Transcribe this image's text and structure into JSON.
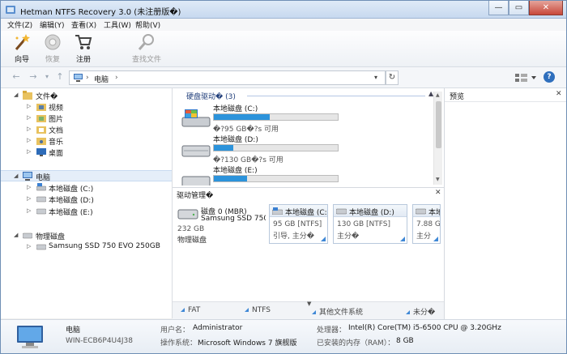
{
  "window": {
    "title": "Hetman NTFS Recovery 3.0 (未注册版�)",
    "minimize_glyph": "—",
    "maximize_glyph": "▭",
    "close_glyph": "✕"
  },
  "menu": [
    "文件(Z)",
    "编辑(Y)",
    "查看(X)",
    "工具(W)",
    "帮助(V)"
  ],
  "toolbar": {
    "wizard": "向导",
    "restore": "恢复",
    "register": "注册",
    "find": "查找文件"
  },
  "address": {
    "path": "电脑",
    "sep_glyph": "›"
  },
  "tree": {
    "files_group": "文件�",
    "folders": [
      "视频",
      "图片",
      "文档",
      "音乐",
      "桌面"
    ],
    "computer_group": "电脑",
    "drives": [
      "本地磁盘 (C:)",
      "本地磁盘 (D:)",
      "本地磁盘 (E:)"
    ],
    "physical_group": "物理磁盘",
    "disks": [
      "Samsung SSD 750 EVO 250GB"
    ]
  },
  "volumes": {
    "group_label": "硬盘驱动� (3)",
    "items": [
      {
        "name": "本地磁盘 (C:)",
        "size": "�?95 GB�?s 可用",
        "used": 0.45
      },
      {
        "name": "本地磁盘 (D:)",
        "size": "�?130 GB�?s 可用",
        "used": 0.16
      },
      {
        "name": "本地磁盘 (E:)",
        "size": "",
        "used": 0.27
      }
    ]
  },
  "disk_manager": {
    "title": "驱动管理�",
    "disk": {
      "name": "磁盘 0 (MBR)",
      "model": "Samsung SSD 750 EVO 250GB",
      "size": "232 GB",
      "type": "物理磁盘"
    },
    "partitions": [
      {
        "name": "本地磁盘 (C:)",
        "size": "95 GB [NTFS]",
        "flags": "引导, 主分�"
      },
      {
        "name": "本地磁盘 (D:)",
        "size": "130 GB [NTFS]",
        "flags": "主分�"
      },
      {
        "name": "本地",
        "size": "7.88 G",
        "flags": "主分"
      }
    ]
  },
  "legend": [
    "FAT",
    "NTFS",
    "其他文件系统",
    "未分�"
  ],
  "preview": {
    "title": "预览"
  },
  "status": {
    "computer_name": "电脑",
    "hostname": "WIN-ECB6P4U4J38",
    "user_label": "用户名：",
    "user_value": "Administrator",
    "os_label": "操作系统：",
    "os_value": "Microsoft Windows 7 旗舰版",
    "cpu_label": "处理器：",
    "cpu_value": "Intel(R) Core(TM) i5-6500 CPU @ 3.20GHz",
    "ram_label": "已安装的内存（RAM）：",
    "ram_value": "8 GB"
  },
  "colors": {
    "accent": "#2c93db",
    "title_gradient_top": "#dfeaf7",
    "selection": "#e5eef9"
  }
}
